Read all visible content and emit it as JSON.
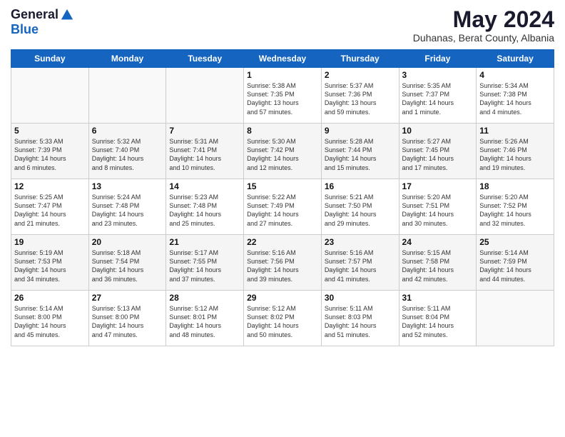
{
  "logo": {
    "general": "General",
    "blue": "Blue"
  },
  "header": {
    "month_title": "May 2024",
    "subtitle": "Duhanas, Berat County, Albania"
  },
  "weekdays": [
    "Sunday",
    "Monday",
    "Tuesday",
    "Wednesday",
    "Thursday",
    "Friday",
    "Saturday"
  ],
  "weeks": [
    [
      {
        "day": "",
        "content": ""
      },
      {
        "day": "",
        "content": ""
      },
      {
        "day": "",
        "content": ""
      },
      {
        "day": "1",
        "content": "Sunrise: 5:38 AM\nSunset: 7:35 PM\nDaylight: 13 hours\nand 57 minutes."
      },
      {
        "day": "2",
        "content": "Sunrise: 5:37 AM\nSunset: 7:36 PM\nDaylight: 13 hours\nand 59 minutes."
      },
      {
        "day": "3",
        "content": "Sunrise: 5:35 AM\nSunset: 7:37 PM\nDaylight: 14 hours\nand 1 minute."
      },
      {
        "day": "4",
        "content": "Sunrise: 5:34 AM\nSunset: 7:38 PM\nDaylight: 14 hours\nand 4 minutes."
      }
    ],
    [
      {
        "day": "5",
        "content": "Sunrise: 5:33 AM\nSunset: 7:39 PM\nDaylight: 14 hours\nand 6 minutes."
      },
      {
        "day": "6",
        "content": "Sunrise: 5:32 AM\nSunset: 7:40 PM\nDaylight: 14 hours\nand 8 minutes."
      },
      {
        "day": "7",
        "content": "Sunrise: 5:31 AM\nSunset: 7:41 PM\nDaylight: 14 hours\nand 10 minutes."
      },
      {
        "day": "8",
        "content": "Sunrise: 5:30 AM\nSunset: 7:42 PM\nDaylight: 14 hours\nand 12 minutes."
      },
      {
        "day": "9",
        "content": "Sunrise: 5:28 AM\nSunset: 7:44 PM\nDaylight: 14 hours\nand 15 minutes."
      },
      {
        "day": "10",
        "content": "Sunrise: 5:27 AM\nSunset: 7:45 PM\nDaylight: 14 hours\nand 17 minutes."
      },
      {
        "day": "11",
        "content": "Sunrise: 5:26 AM\nSunset: 7:46 PM\nDaylight: 14 hours\nand 19 minutes."
      }
    ],
    [
      {
        "day": "12",
        "content": "Sunrise: 5:25 AM\nSunset: 7:47 PM\nDaylight: 14 hours\nand 21 minutes."
      },
      {
        "day": "13",
        "content": "Sunrise: 5:24 AM\nSunset: 7:48 PM\nDaylight: 14 hours\nand 23 minutes."
      },
      {
        "day": "14",
        "content": "Sunrise: 5:23 AM\nSunset: 7:48 PM\nDaylight: 14 hours\nand 25 minutes."
      },
      {
        "day": "15",
        "content": "Sunrise: 5:22 AM\nSunset: 7:49 PM\nDaylight: 14 hours\nand 27 minutes."
      },
      {
        "day": "16",
        "content": "Sunrise: 5:21 AM\nSunset: 7:50 PM\nDaylight: 14 hours\nand 29 minutes."
      },
      {
        "day": "17",
        "content": "Sunrise: 5:20 AM\nSunset: 7:51 PM\nDaylight: 14 hours\nand 30 minutes."
      },
      {
        "day": "18",
        "content": "Sunrise: 5:20 AM\nSunset: 7:52 PM\nDaylight: 14 hours\nand 32 minutes."
      }
    ],
    [
      {
        "day": "19",
        "content": "Sunrise: 5:19 AM\nSunset: 7:53 PM\nDaylight: 14 hours\nand 34 minutes."
      },
      {
        "day": "20",
        "content": "Sunrise: 5:18 AM\nSunset: 7:54 PM\nDaylight: 14 hours\nand 36 minutes."
      },
      {
        "day": "21",
        "content": "Sunrise: 5:17 AM\nSunset: 7:55 PM\nDaylight: 14 hours\nand 37 minutes."
      },
      {
        "day": "22",
        "content": "Sunrise: 5:16 AM\nSunset: 7:56 PM\nDaylight: 14 hours\nand 39 minutes."
      },
      {
        "day": "23",
        "content": "Sunrise: 5:16 AM\nSunset: 7:57 PM\nDaylight: 14 hours\nand 41 minutes."
      },
      {
        "day": "24",
        "content": "Sunrise: 5:15 AM\nSunset: 7:58 PM\nDaylight: 14 hours\nand 42 minutes."
      },
      {
        "day": "25",
        "content": "Sunrise: 5:14 AM\nSunset: 7:59 PM\nDaylight: 14 hours\nand 44 minutes."
      }
    ],
    [
      {
        "day": "26",
        "content": "Sunrise: 5:14 AM\nSunset: 8:00 PM\nDaylight: 14 hours\nand 45 minutes."
      },
      {
        "day": "27",
        "content": "Sunrise: 5:13 AM\nSunset: 8:00 PM\nDaylight: 14 hours\nand 47 minutes."
      },
      {
        "day": "28",
        "content": "Sunrise: 5:12 AM\nSunset: 8:01 PM\nDaylight: 14 hours\nand 48 minutes."
      },
      {
        "day": "29",
        "content": "Sunrise: 5:12 AM\nSunset: 8:02 PM\nDaylight: 14 hours\nand 50 minutes."
      },
      {
        "day": "30",
        "content": "Sunrise: 5:11 AM\nSunset: 8:03 PM\nDaylight: 14 hours\nand 51 minutes."
      },
      {
        "day": "31",
        "content": "Sunrise: 5:11 AM\nSunset: 8:04 PM\nDaylight: 14 hours\nand 52 minutes."
      },
      {
        "day": "",
        "content": ""
      }
    ]
  ]
}
